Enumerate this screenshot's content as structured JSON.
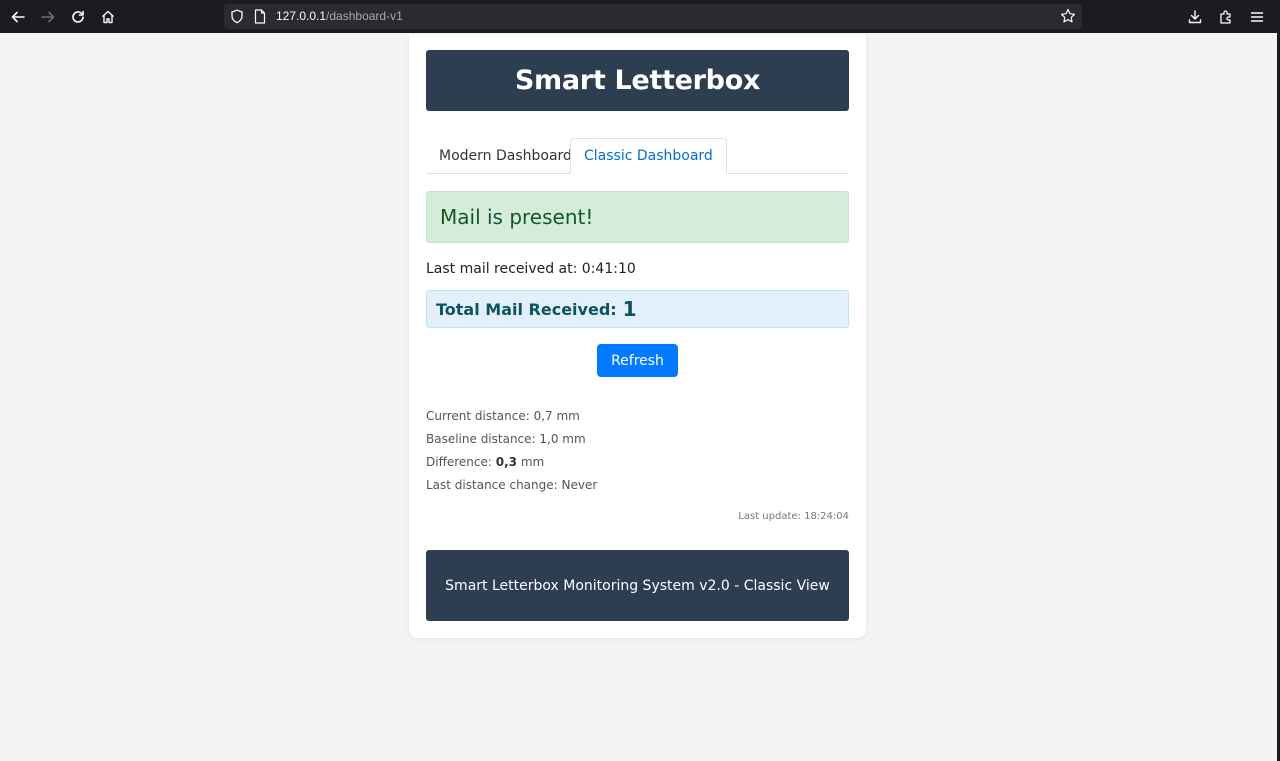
{
  "browser": {
    "url_host": "127.0.0.1",
    "url_path": "/dashboard-v1",
    "icons": [
      "back-icon",
      "forward-icon",
      "reload-icon",
      "home-icon",
      "shield-icon",
      "page-icon",
      "star-icon",
      "download-icon",
      "extensions-icon",
      "menu-icon"
    ]
  },
  "header": {
    "title": "Smart Letterbox"
  },
  "tabs": [
    {
      "label": "Modern Dashboard",
      "active": false
    },
    {
      "label": "Classic Dashboard",
      "active": true
    }
  ],
  "status": {
    "message": "Mail is present!"
  },
  "last_mail": {
    "text": "Last mail received at: 0:41:10"
  },
  "total": {
    "label": "Total Mail Received:",
    "value": "1"
  },
  "refresh": {
    "label": "Refresh"
  },
  "distance": {
    "current": "Current distance: 0,7 mm",
    "baseline": "Baseline distance: 1,0 mm",
    "difference_label": "Difference:",
    "difference_value": "0,3",
    "difference_unit": "mm",
    "last_change": "Last distance change: Never"
  },
  "last_update": "Last update: 18:24:04",
  "footer": {
    "text": "Smart Letterbox Monitoring System v2.0 - Classic View"
  },
  "colors": {
    "header_bg": "#2c3e50",
    "accent": "#007bff",
    "success_bg": "#d4edda",
    "info_bg": "#e3f0fb"
  }
}
